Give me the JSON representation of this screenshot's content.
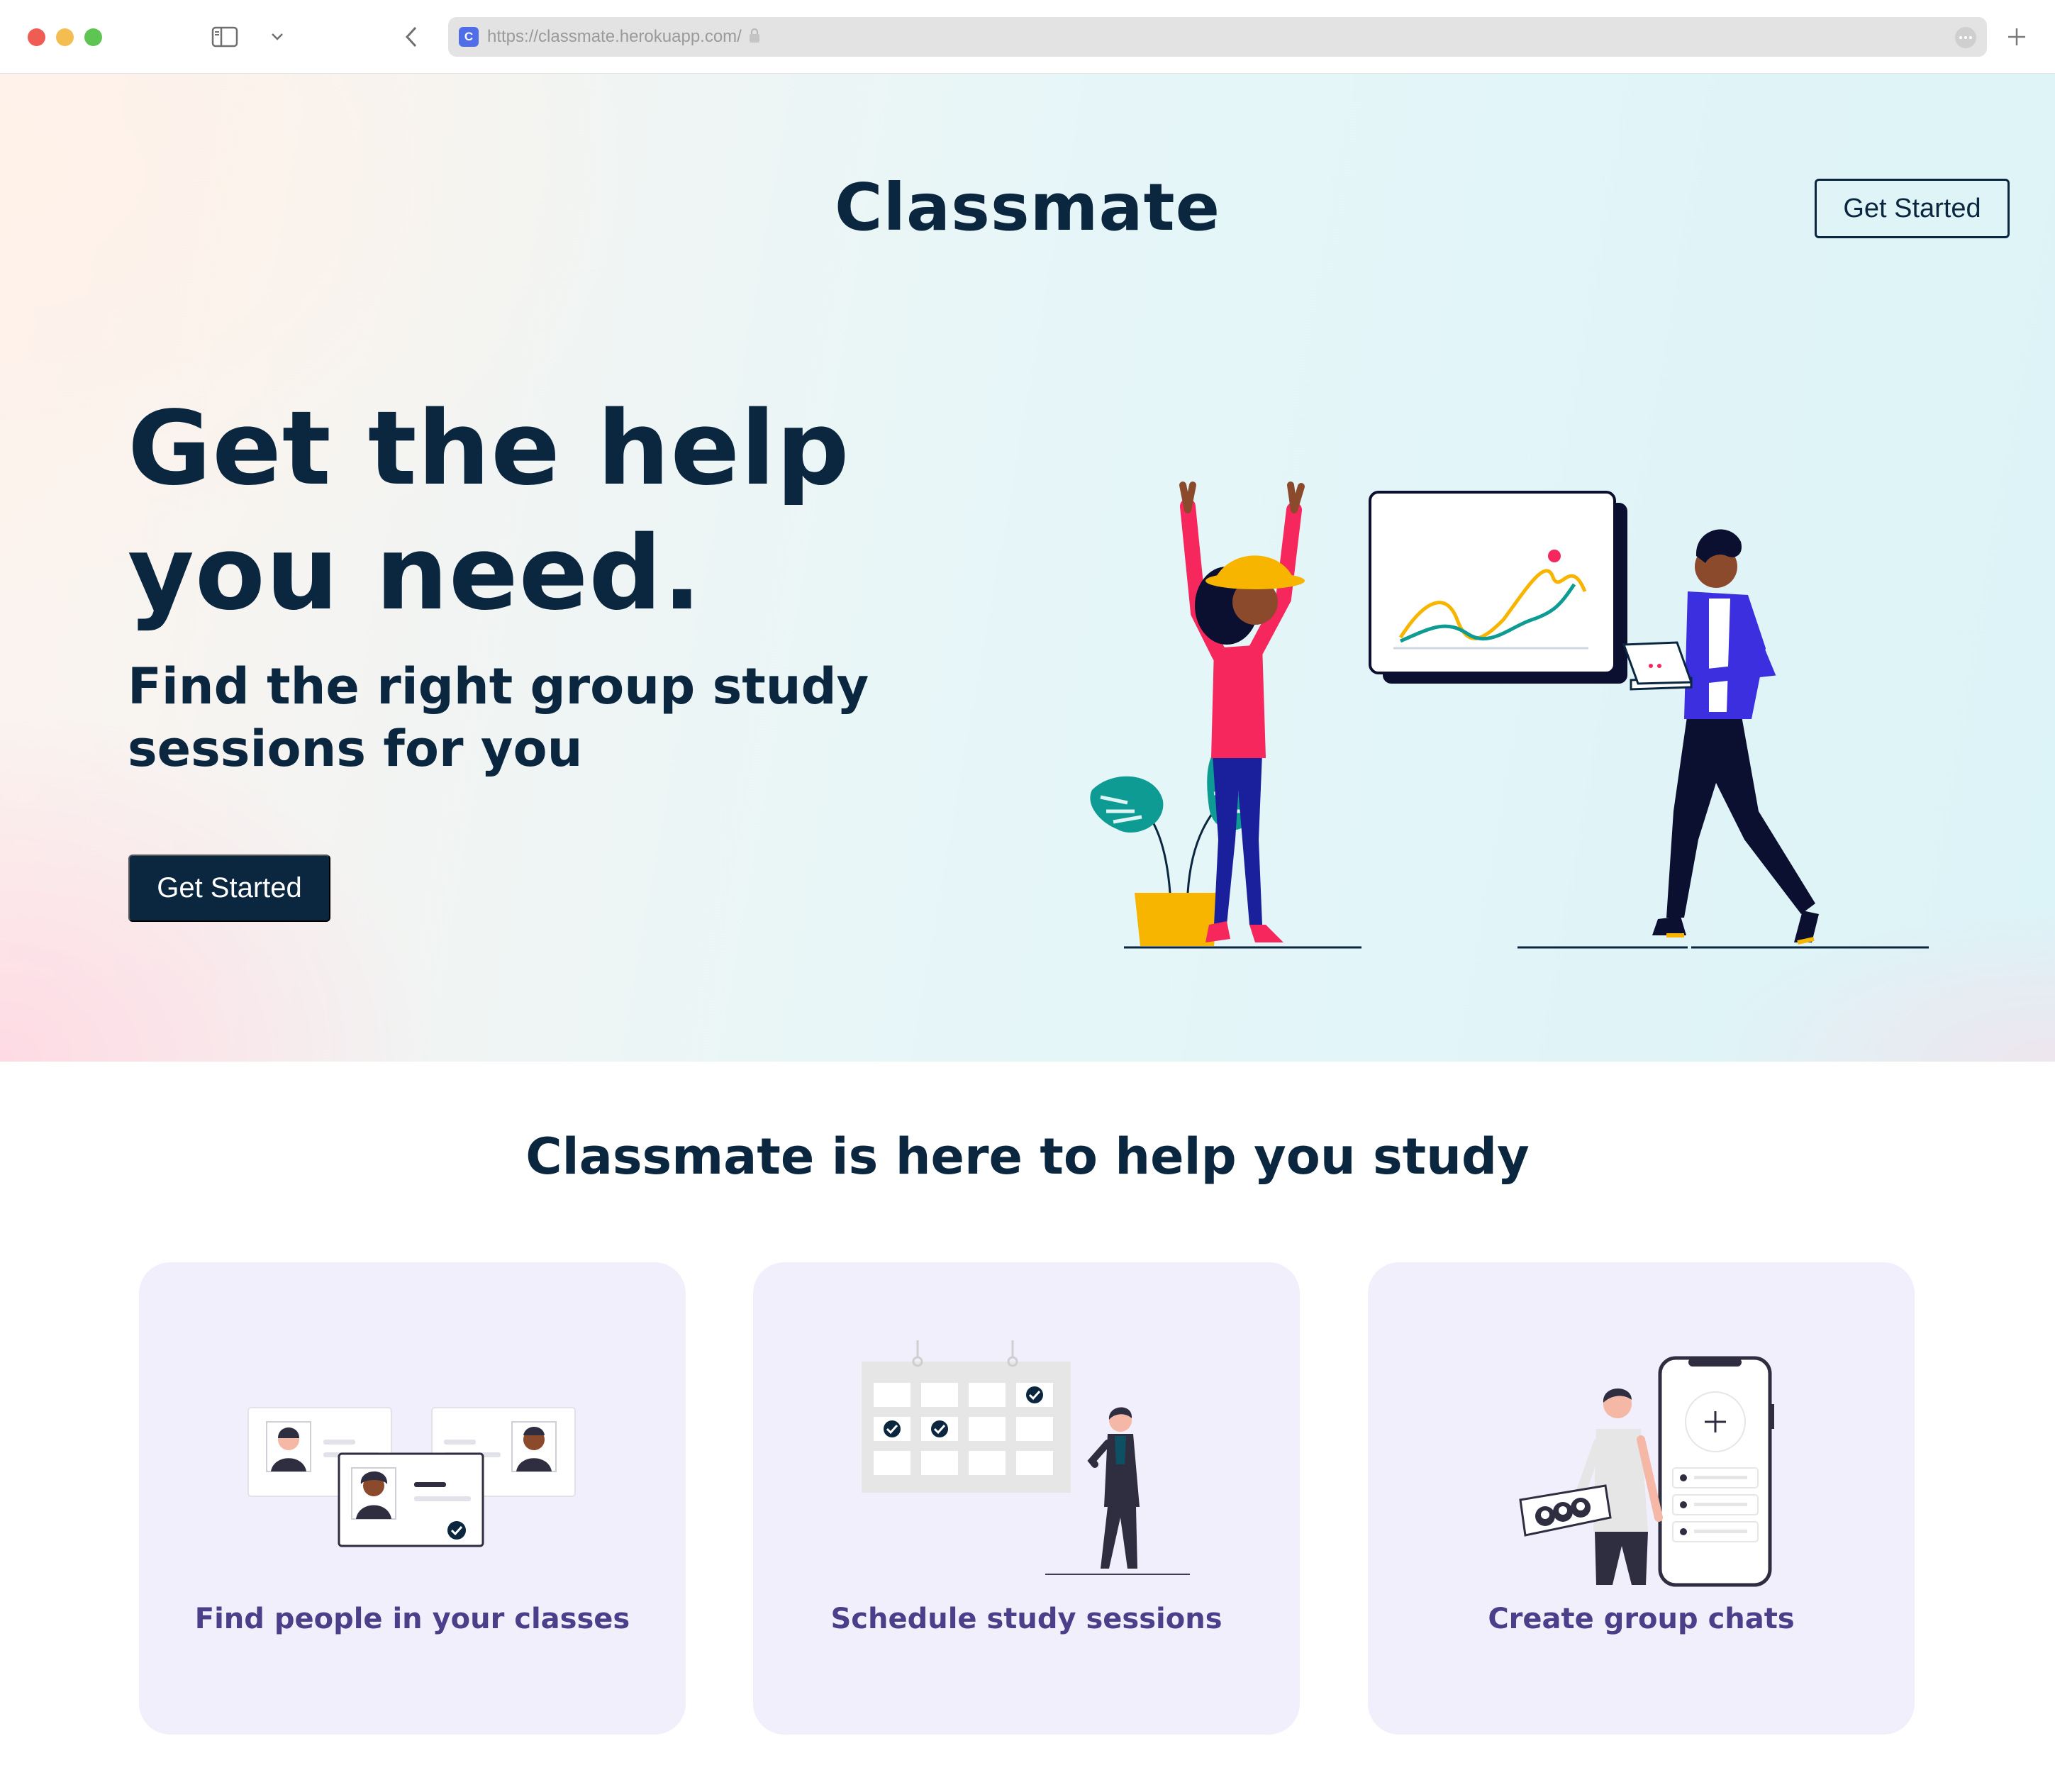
{
  "browser": {
    "url": "https://classmate.herokuapp.com/",
    "favicon_letter": "C"
  },
  "header": {
    "brand": "Classmate",
    "cta_label": "Get Started"
  },
  "hero": {
    "headline_line1": "Get the help",
    "headline_line2": "you need.",
    "subhead_line1": "Find the right group study",
    "subhead_line2": "sessions for you",
    "cta_label": "Get Started"
  },
  "features": {
    "title": "Classmate is here to help you study",
    "cards": [
      {
        "label": "Find people in your classes",
        "icon": "people-cards-illustration"
      },
      {
        "label": "Schedule study sessions",
        "icon": "calendar-illustration"
      },
      {
        "label": "Create group chats",
        "icon": "phone-chat-illustration"
      }
    ]
  },
  "colors": {
    "navy": "#0b2740",
    "card_bg": "#f1effc",
    "card_label": "#4c3f8a",
    "accent_pink": "#f5275c",
    "accent_yellow": "#f7b500",
    "accent_teal": "#0d9b94",
    "accent_blue": "#3b2fe0"
  }
}
